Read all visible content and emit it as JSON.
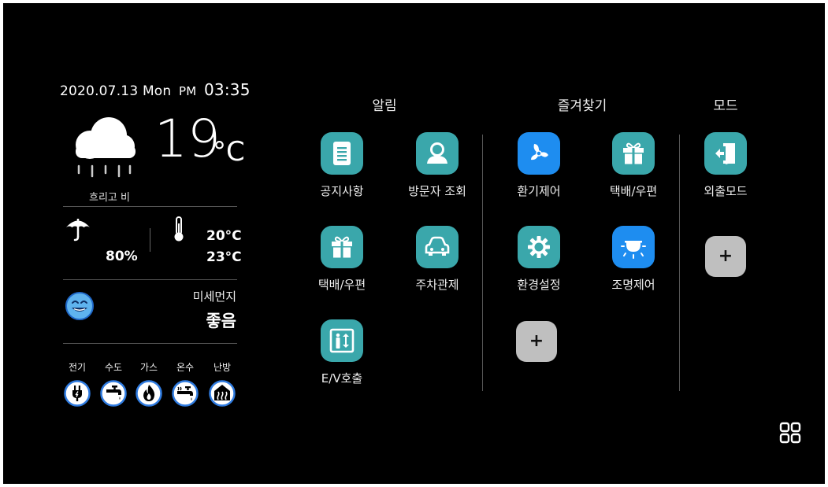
{
  "status": {
    "date": "2020.07.13 Mon",
    "ampm": "PM",
    "time": "03:35"
  },
  "weather": {
    "icon": "cloud-rain-icon",
    "temperature": "19",
    "unit": "°C",
    "description": "흐리고 비",
    "humidity": "80%",
    "temp_high": "20°C",
    "temp_low": "23°C"
  },
  "dust": {
    "label": "미세먼지",
    "value": "좋음",
    "icon": "smile-face-icon"
  },
  "utilities": [
    {
      "label": "전기",
      "icon": "plug-icon"
    },
    {
      "label": "수도",
      "icon": "faucet-icon"
    },
    {
      "label": "가스",
      "icon": "flame-icon"
    },
    {
      "label": "온수",
      "icon": "hot-water-icon"
    },
    {
      "label": "난방",
      "icon": "heating-icon"
    }
  ],
  "sections": {
    "alerts": {
      "title": "알림",
      "items": [
        {
          "label": "공지사항",
          "icon": "notice-icon"
        },
        {
          "label": "방문자 조회",
          "icon": "visitor-icon"
        },
        {
          "label": "택배/우편",
          "icon": "gift-icon"
        },
        {
          "label": "주차관제",
          "icon": "car-icon"
        },
        {
          "label": "E/V호출",
          "icon": "elevator-icon"
        }
      ]
    },
    "favorites": {
      "title": "즐겨찾기",
      "items": [
        {
          "label": "환기제어",
          "icon": "fan-icon"
        },
        {
          "label": "택배/우편",
          "icon": "gift-icon"
        },
        {
          "label": "환경설정",
          "icon": "gear-icon"
        },
        {
          "label": "조명제어",
          "icon": "light-icon"
        }
      ],
      "add_label": "+"
    },
    "mode": {
      "title": "모드",
      "items": [
        {
          "label": "외출모드",
          "icon": "exit-door-icon"
        }
      ],
      "add_label": "+"
    }
  },
  "colors": {
    "background": "#000000",
    "teal": "#3aa7ab",
    "blue": "#1e8df0",
    "utility_ring": "#2f7be0",
    "add_tile": "#bfbfbf"
  }
}
